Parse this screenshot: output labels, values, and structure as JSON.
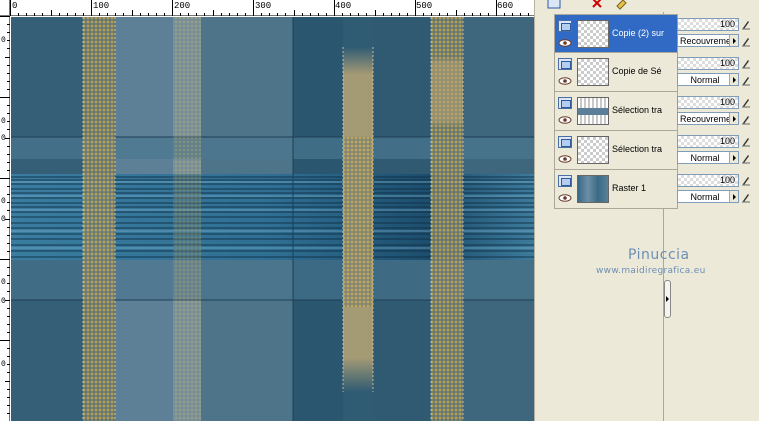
{
  "canvas": {
    "ruler_top_labels": [
      "0",
      "100",
      "200",
      "300",
      "400",
      "500",
      "600"
    ],
    "ruler_left_labels": [
      "0",
      "0",
      "0",
      "0",
      "0",
      "0",
      "0",
      "0"
    ]
  },
  "palette": {
    "toolbar": {
      "new_layer_icon": "new-layer-icon",
      "delete_icon": "delete-layer-icon",
      "properties_icon": "layer-properties-icon"
    },
    "layers": [
      {
        "name": "Copie (2) sur",
        "thumb": "checker",
        "selected": true
      },
      {
        "name": "Copie de Sé",
        "thumb": "checker",
        "selected": false
      },
      {
        "name": "Sélection tra",
        "thumb": "selection",
        "selected": false
      },
      {
        "name": "Sélection tra",
        "thumb": "checker",
        "selected": false
      },
      {
        "name": "Raster 1",
        "thumb": "raster",
        "selected": false
      }
    ],
    "props": [
      {
        "opacity": "100",
        "blend": "Recouvrement"
      },
      {
        "opacity": "100",
        "blend": "Normal"
      },
      {
        "opacity": "100",
        "blend": "Recouvrement"
      },
      {
        "opacity": "100",
        "blend": "Normal"
      },
      {
        "opacity": "100",
        "blend": "Normal"
      }
    ],
    "watermark": {
      "name": "Pinuccia",
      "url": "www.maidiregrafica.eu"
    }
  },
  "colors": {
    "selected_row": "#316ac5",
    "panel_bg": "#ece9d8",
    "image_base": "#2e5a72",
    "watermark": "#6d8fb4"
  }
}
